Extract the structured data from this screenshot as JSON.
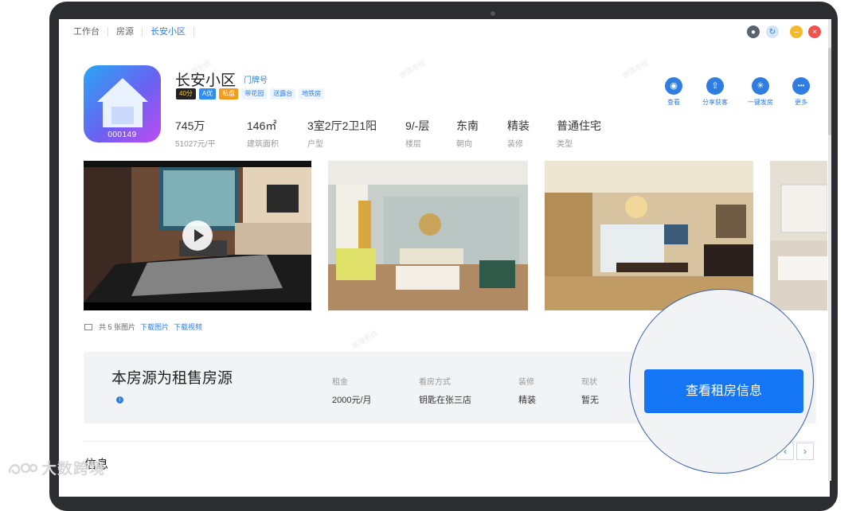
{
  "nav": {
    "tabs": [
      {
        "label": "工作台",
        "active": false
      },
      {
        "label": "房源",
        "active": false
      },
      {
        "label": "长安小区",
        "active": true
      }
    ]
  },
  "window_controls": [
    {
      "icon": "avatar-icon",
      "color": "#5a6470"
    },
    {
      "icon": "refresh-icon",
      "color": "#d6e4f7"
    },
    {
      "icon": "minimize-icon",
      "color": "#f5b92c"
    },
    {
      "icon": "close-icon",
      "color": "#ef5350"
    }
  ],
  "property": {
    "icon_code": "000149",
    "title": "长安小区",
    "door_number_link": "门牌号",
    "tags": {
      "score": "40分",
      "grade": "A优",
      "private": "私盘",
      "features": [
        "带花园",
        "送露台",
        "地铁房"
      ]
    },
    "stats": [
      {
        "value": "745万",
        "label": "51027元/平"
      },
      {
        "value": "146㎡",
        "label": "建筑面积"
      },
      {
        "value": "3室2厅2卫1阳",
        "label": "户型"
      },
      {
        "value": "9/-层",
        "label": "楼层"
      },
      {
        "value": "东南",
        "label": "朝向"
      },
      {
        "value": "精装",
        "label": "装修"
      },
      {
        "value": "普通住宅",
        "label": "类型"
      }
    ]
  },
  "actions": [
    {
      "label": "查看",
      "icon": "eye-icon",
      "glyph": "◉"
    },
    {
      "label": "分享获客",
      "icon": "share-icon",
      "glyph": "⇧"
    },
    {
      "label": "一键发房",
      "icon": "publish-icon",
      "glyph": "✳"
    },
    {
      "label": "更多",
      "icon": "more-icon",
      "glyph": "•••"
    }
  ],
  "gallery": {
    "summary": "共 5 张图片",
    "download_images": "下载图片",
    "download_video": "下载视频"
  },
  "rent": {
    "title": "本房源为租售房源",
    "info_icon": "i",
    "fields": [
      {
        "label": "租金",
        "value": "2000元/月"
      },
      {
        "label": "看房方式",
        "value": "钥匙在张三店"
      },
      {
        "label": "装修",
        "value": "精装"
      },
      {
        "label": "现状",
        "value": "暂无"
      }
    ],
    "cta": "查看租房信息"
  },
  "section": {
    "title": "信息"
  },
  "pager": {
    "prev": "‹",
    "next": "›"
  },
  "brand": {
    "name": "大数跨境"
  }
}
